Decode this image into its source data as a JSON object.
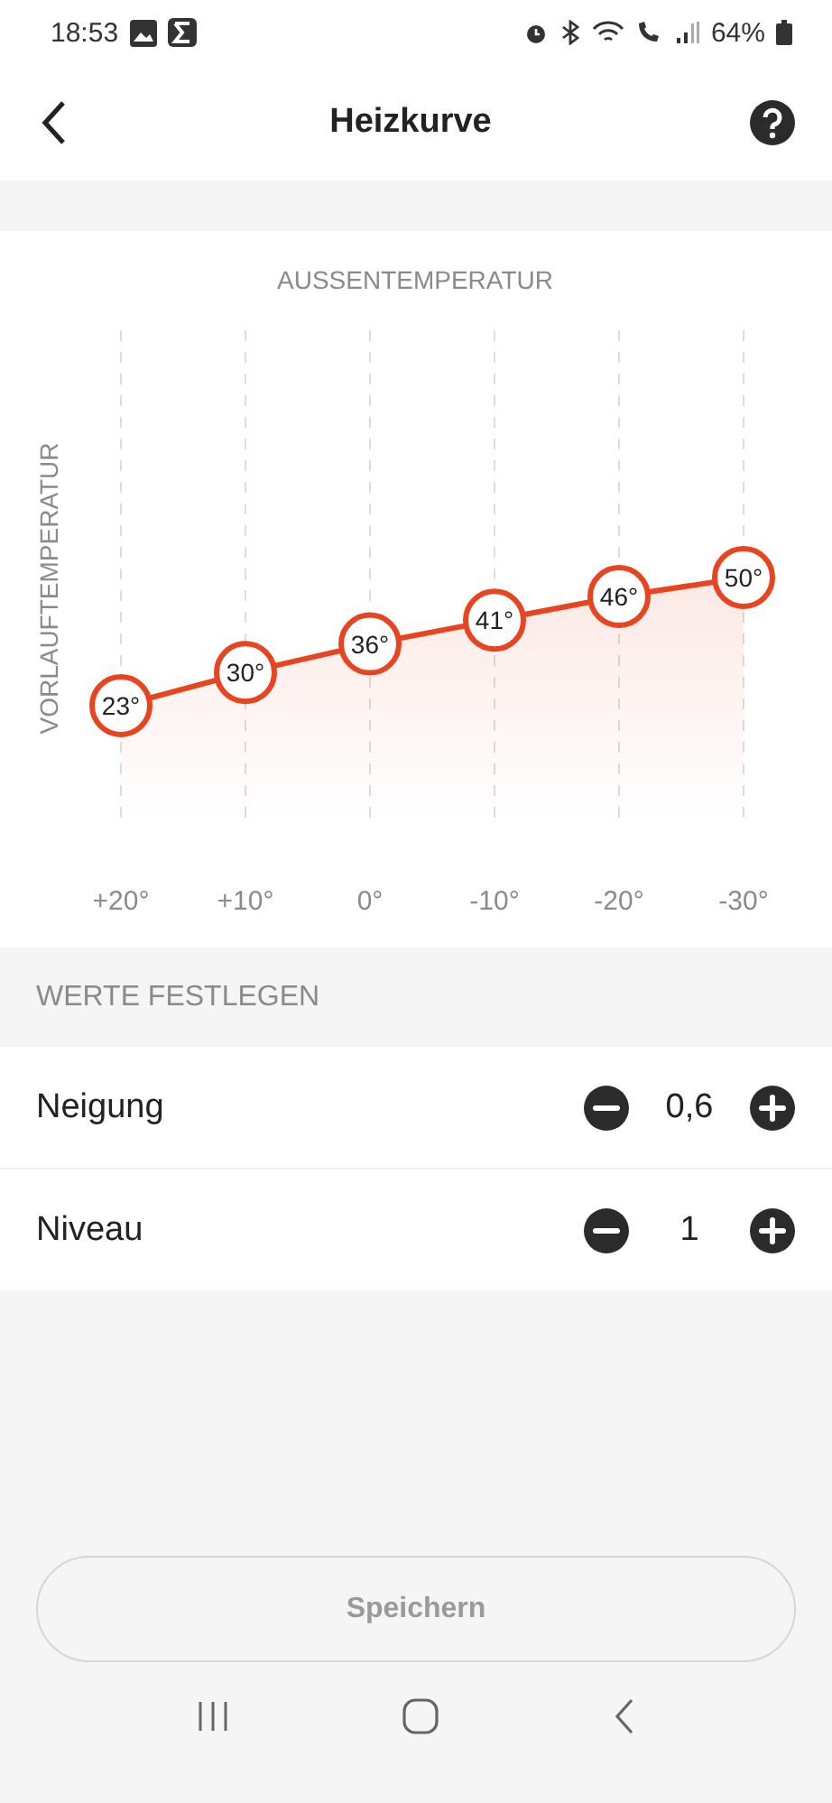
{
  "status_bar": {
    "time": "18:53",
    "battery": "64%"
  },
  "header": {
    "title": "Heizkurve"
  },
  "chart": {
    "chart_data": {
      "type": "area",
      "title": "AUSSENTEMPERATUR",
      "ylabel": "VORLAUFTEMPERATUR",
      "categories": [
        "+20°",
        "+10°",
        "0°",
        "-10°",
        "-20°",
        "-30°"
      ],
      "grid": true,
      "series": [
        {
          "color": "#e8441f",
          "marker": "o",
          "values": [
            23,
            30,
            36,
            41,
            46,
            50
          ],
          "value_labels": [
            "23°",
            "30°",
            "36°",
            "41°",
            "46°",
            "50°"
          ]
        }
      ]
    }
  },
  "settings": {
    "heading": "WERTE FESTLEGEN",
    "rows": [
      {
        "label": "Neigung",
        "value": "0,6"
      },
      {
        "label": "Niveau",
        "value": "1"
      }
    ]
  },
  "save_button": {
    "label": "Speichern",
    "disabled": true
  }
}
